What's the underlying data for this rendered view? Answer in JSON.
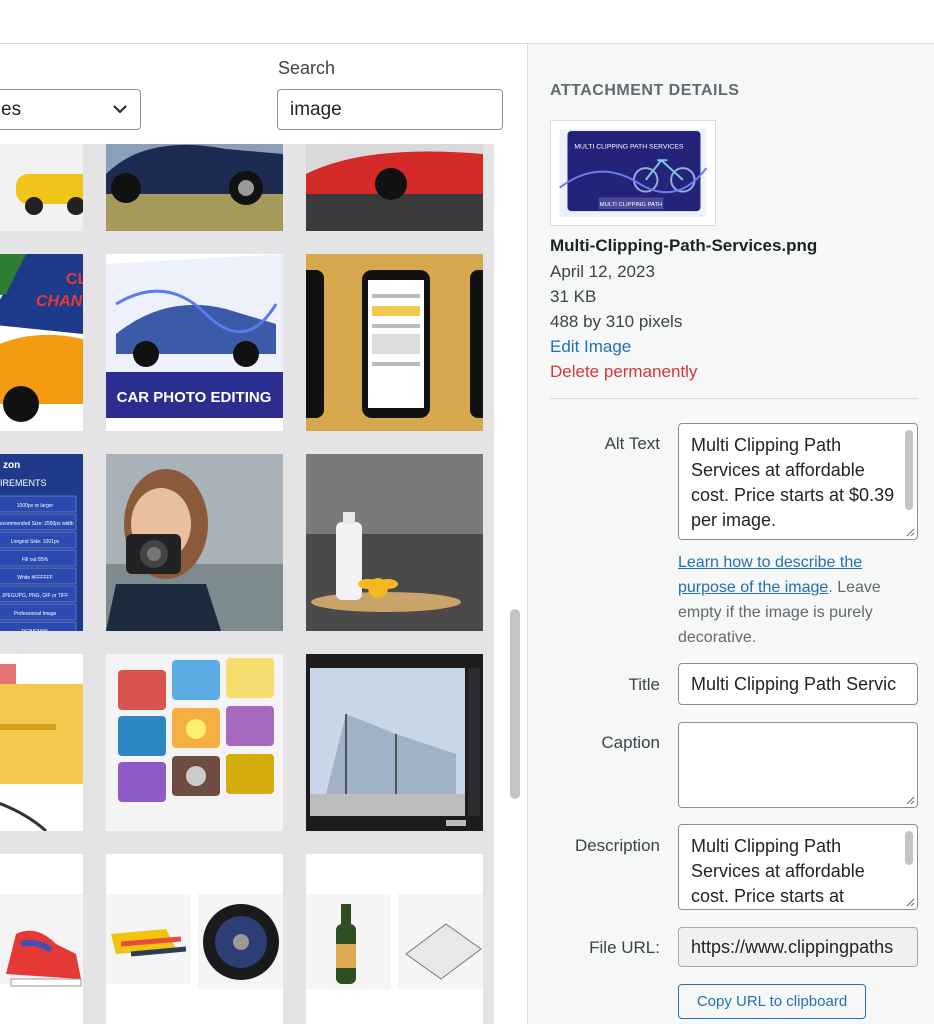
{
  "filter": {
    "value": "es"
  },
  "search": {
    "label": "Search",
    "value": "image"
  },
  "grid": {
    "car_editing_text": "CAR PHOTO EDITING",
    "amazon_heading": "zon",
    "amazon_sub": "IREMENTS",
    "amazon_rows": [
      "1000px or larger",
      "Recommended Size: 2560px width",
      "Longest Side: 1001px",
      "Fill out 85%",
      "White #FFFFFF",
      "JPEG/JPG, PNG, GIF or TIFF",
      "Professional Image",
      "RGB/CMYK"
    ],
    "promo_text_1": "CL",
    "promo_text_2": "CHAN"
  },
  "details": {
    "heading": "ATTACHMENT DETAILS",
    "thumb_title": "MULTI CLIPPING PATH SERVICES",
    "thumb_button": "MULTI CLIPPING PATH",
    "filename": "Multi-Clipping-Path-Services.png",
    "date": "April 12, 2023",
    "size": "31 KB",
    "dimensions": "488 by 310 pixels",
    "edit_link": "Edit Image",
    "delete_link": "Delete permanently"
  },
  "fields": {
    "alt_label": "Alt Text",
    "alt_value": "Multi Clipping Path Services at affordable cost. Price starts at $0.39 per image.",
    "help_link": "Learn how to describe the purpose of the image",
    "help_rest": ". Leave empty if the image is purely decorative.",
    "title_label": "Title",
    "title_value": "Multi Clipping Path Servic",
    "caption_label": "Caption",
    "caption_value": "",
    "description_label": "Description",
    "description_value": "Multi Clipping Path Services at affordable cost. Price starts at",
    "url_label": "File URL:",
    "url_value": "https://www.clippingpaths",
    "copy_button": "Copy URL to clipboard"
  },
  "colors": {
    "accent": "#2271b1",
    "danger": "#d63638",
    "panel": "#f6f7f7"
  }
}
